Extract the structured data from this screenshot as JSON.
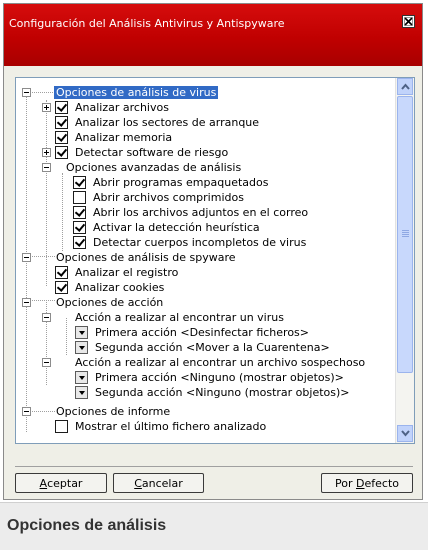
{
  "dialog": {
    "title": "Configuración del Análisis Antivirus y Antispyware",
    "accent_color": "#c00000",
    "close_icon": "close-icon"
  },
  "tree": {
    "virus_section": {
      "label": "Opciones de análisis de virus",
      "items": [
        {
          "label": "Analizar archivos",
          "checked": true
        },
        {
          "label": "Analizar los sectores de arranque",
          "checked": true
        },
        {
          "label": "Analizar memoria",
          "checked": true
        },
        {
          "label": "Detectar software de riesgo",
          "checked": true
        }
      ],
      "advanced": {
        "label": "Opciones avanzadas de análisis",
        "items": [
          {
            "label": "Abrir programas empaquetados",
            "checked": true
          },
          {
            "label": "Abrir archivos comprimidos",
            "checked": false
          },
          {
            "label": "Abrir los archivos adjuntos en el correo",
            "checked": true
          },
          {
            "label": "Activar la detección heurística",
            "checked": true
          },
          {
            "label": "Detectar cuerpos incompletos de virus",
            "checked": true
          }
        ]
      }
    },
    "spyware_section": {
      "label": "Opciones de análisis de spyware",
      "items": [
        {
          "label": "Analizar el registro",
          "checked": true
        },
        {
          "label": "Analizar cookies",
          "checked": true
        }
      ]
    },
    "action_section": {
      "label": "Opciones de acción",
      "virus_group": {
        "label": "Acción a realizar al encontrar un virus",
        "first": "Primera acción <Desinfectar ficheros>",
        "second": "Segunda acción <Mover a la Cuarentena>"
      },
      "suspect_group": {
        "label": "Acción a realizar al encontrar un archivo sospechoso",
        "first": "Primera acción <Ninguno (mostrar objetos)>",
        "second": "Segunda acción <Ninguno (mostrar objetos)>"
      }
    },
    "report_section": {
      "label": "Opciones de informe",
      "items": [
        {
          "label": "Mostrar el último fichero analizado",
          "checked": false
        }
      ]
    }
  },
  "buttons": {
    "accept_mnemonic": "A",
    "accept_rest": "ceptar",
    "cancel_mnemonic": "C",
    "cancel_rest": "ancelar",
    "default_prefix": "Por ",
    "default_mnemonic": "D",
    "default_rest": "efecto"
  },
  "caption": {
    "text": "Opciones de análisis"
  }
}
